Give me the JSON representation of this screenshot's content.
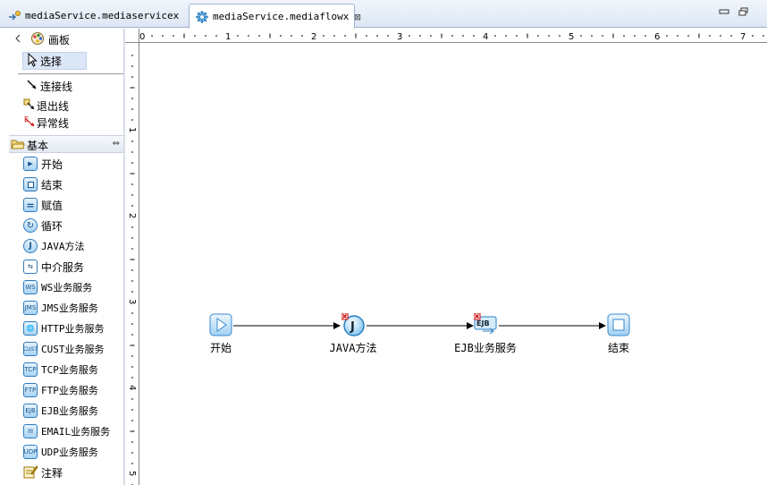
{
  "tabs": [
    {
      "label": "mediaService.mediaservicex",
      "icon": "service-icon",
      "active": false
    },
    {
      "label": "mediaService.mediaflowx",
      "icon": "flow-icon",
      "active": true
    }
  ],
  "window": {
    "minimize": "▭",
    "restore": "🗗"
  },
  "palette": {
    "header": "画板",
    "tools": [
      {
        "label": "选择",
        "icon": "cursor-icon"
      },
      {
        "label": "连接线",
        "icon": "connection-icon"
      },
      {
        "label": "退出线",
        "icon": "exit-line-icon"
      },
      {
        "label": "异常线",
        "icon": "exception-line-icon"
      }
    ],
    "drawer": "基本",
    "items": [
      {
        "label": "开始",
        "icon": "start-icon"
      },
      {
        "label": "结束",
        "icon": "end-icon"
      },
      {
        "label": "赋值",
        "icon": "assign-icon"
      },
      {
        "label": "循环",
        "icon": "loop-icon"
      },
      {
        "label": "JAVA方法",
        "icon": "java-icon"
      },
      {
        "label": "中介服务",
        "icon": "mediation-icon"
      },
      {
        "label": "WS业务服务",
        "icon": "ws-icon"
      },
      {
        "label": "JMS业务服务",
        "icon": "jms-icon"
      },
      {
        "label": "HTTP业务服务",
        "icon": "http-icon"
      },
      {
        "label": "CUST业务服务",
        "icon": "cust-icon"
      },
      {
        "label": "TCP业务服务",
        "icon": "tcp-icon"
      },
      {
        "label": "FTP业务服务",
        "icon": "ftp-icon"
      },
      {
        "label": "EJB业务服务",
        "icon": "ejb-icon"
      },
      {
        "label": "EMAIL业务服务",
        "icon": "email-icon"
      },
      {
        "label": "UDP业务服务",
        "icon": "udp-icon"
      },
      {
        "label": "注释",
        "icon": "note-icon"
      }
    ]
  },
  "ruler": {
    "h_labels": [
      "0",
      "1",
      "2",
      "3",
      "4",
      "5",
      "6",
      "7"
    ],
    "v_labels": [
      "1",
      "2",
      "3",
      "4",
      "5"
    ]
  },
  "flow": {
    "nodes": [
      {
        "label": "开始",
        "icon": "start-icon"
      },
      {
        "label": "JAVA方法",
        "icon": "java-icon"
      },
      {
        "label": "EJB业务服务",
        "icon": "ejb-icon"
      },
      {
        "label": "结束",
        "icon": "end-icon"
      }
    ]
  }
}
